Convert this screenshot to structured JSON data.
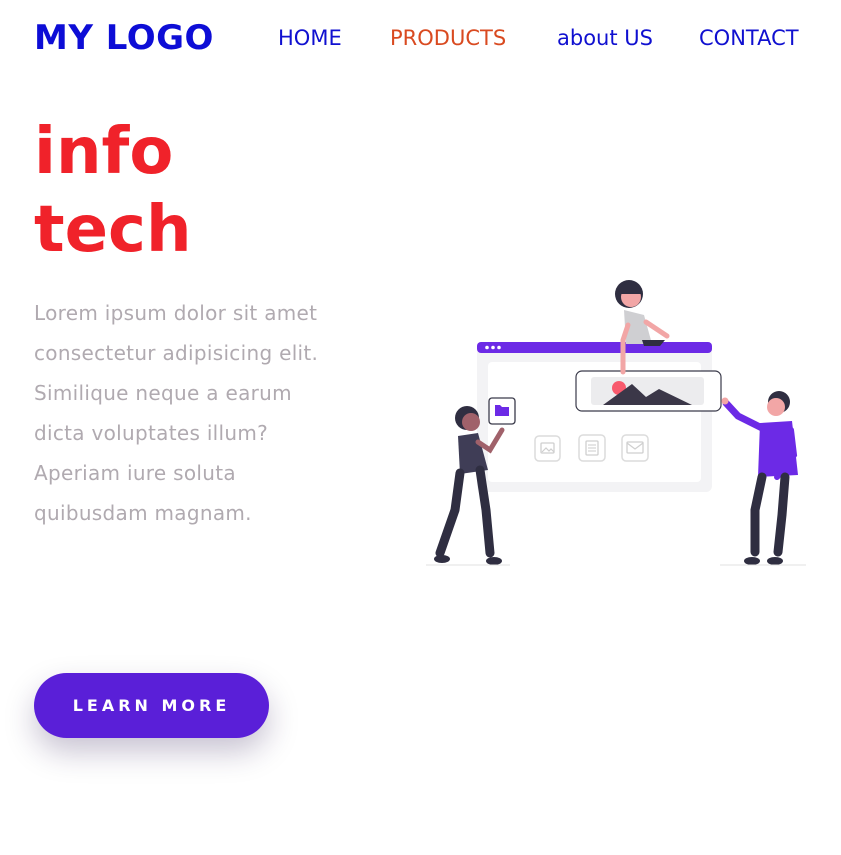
{
  "header": {
    "logo": "MY LOGO",
    "nav": [
      {
        "label": "HOME",
        "active": false
      },
      {
        "label": "PRODUCTS",
        "active": true
      },
      {
        "label": "about US",
        "active": false
      },
      {
        "label": "CONTACT",
        "active": false
      }
    ]
  },
  "hero": {
    "title_line1": "info",
    "title_line2": "tech",
    "text": "Lorem ipsum dolor sit amet consectetur adipisicing elit. Similique neque a earum dicta voluptates illum? Aperiam iure soluta quibusdam magnam.",
    "cta_label": "LEARN MORE"
  },
  "colors": {
    "logo": "#0d0dd6",
    "nav": "#1010d0",
    "nav_active": "#d94a20",
    "title": "#f0222a",
    "text": "#b0aab0",
    "accent": "#5a1fd8"
  },
  "illustration": {
    "icons": [
      "folder-icon",
      "image-icon",
      "document-icon",
      "mail-icon",
      "picture-icon"
    ]
  }
}
